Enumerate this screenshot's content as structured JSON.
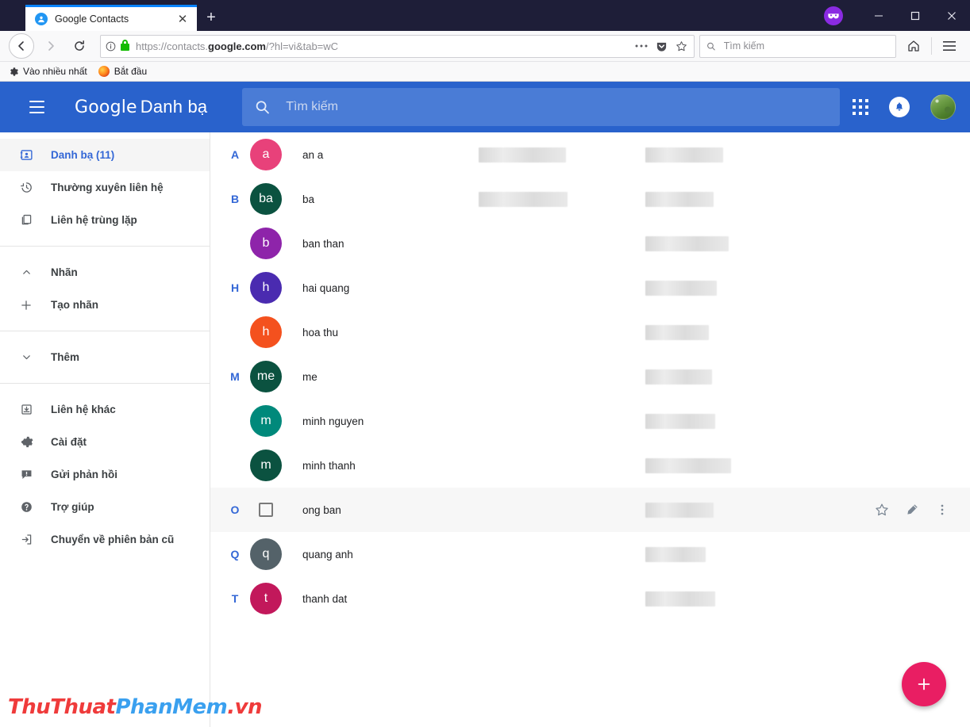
{
  "browser": {
    "tab": {
      "title": "Google Contacts",
      "favicon": "contact-favicon",
      "close_label": "✕"
    },
    "newtab_label": "+",
    "window_controls": {
      "minimize": "–",
      "maximize": "□",
      "close": "✕",
      "extension": "mask-icon"
    },
    "nav": {
      "back": "←",
      "forward": "→",
      "reload": "⟳",
      "home": "⌂",
      "menu": "≡"
    },
    "url": {
      "scheme": "https://contacts.",
      "domain": "google.com",
      "path": "/?hl=vi&tab=wC",
      "full": "https://contacts.google.com/?hl=vi&tab=wC"
    },
    "url_icons": [
      "more-dots-icon",
      "pocket-icon",
      "bookmark-star-icon"
    ],
    "search": {
      "placeholder": "Tìm kiếm",
      "value": ""
    },
    "bookmarks": [
      {
        "label": "Vào nhiều nhất",
        "icon": "gear-icon"
      },
      {
        "label": "Bắt đầu",
        "icon": "firefox-icon"
      }
    ]
  },
  "app": {
    "brand_google": "Google",
    "brand_product": "Danh bạ",
    "search": {
      "placeholder": "Tìm kiếm",
      "value": ""
    },
    "header_icons": [
      "apps-grid-icon",
      "notification-bell-icon",
      "user-avatar"
    ],
    "sidebar": {
      "group1": [
        {
          "label": "Danh bạ (11)",
          "icon": "contact-card-icon",
          "active": true
        },
        {
          "label": "Thường xuyên liên hệ",
          "icon": "history-clock-icon",
          "active": false
        },
        {
          "label": "Liên hệ trùng lặp",
          "icon": "duplicate-copy-icon",
          "active": false
        }
      ],
      "group2": [
        {
          "label": "Nhãn",
          "icon": "chevron-up-icon",
          "active": false
        },
        {
          "label": "Tạo nhãn",
          "icon": "plus-icon",
          "active": false
        }
      ],
      "group3": [
        {
          "label": "Thêm",
          "icon": "chevron-down-icon",
          "active": false
        }
      ],
      "group4": [
        {
          "label": "Liên hệ khác",
          "icon": "inbox-arrow-icon",
          "active": false
        },
        {
          "label": "Cài đặt",
          "icon": "gear-icon",
          "active": false
        },
        {
          "label": "Gửi phản hồi",
          "icon": "feedback-icon",
          "active": false
        },
        {
          "label": "Trợ giúp",
          "icon": "help-circle-icon",
          "active": false
        },
        {
          "label": "Chuyển về phiên bản cũ",
          "icon": "exit-arrow-icon",
          "active": false
        }
      ]
    },
    "contacts": [
      {
        "letter": "A",
        "initials": "a",
        "name": "an a",
        "color": "#e8417a",
        "hovered": false,
        "email_redacted": true,
        "phone_redacted": true,
        "email_w": 110,
        "phone_w": 98
      },
      {
        "letter": "B",
        "initials": "ba",
        "name": "ba",
        "color": "#0b5240",
        "hovered": false,
        "email_redacted": true,
        "phone_redacted": true,
        "email_w": 112,
        "phone_w": 86
      },
      {
        "letter": "",
        "initials": "b",
        "name": "ban than",
        "color": "#8e24aa",
        "hovered": false,
        "email_redacted": false,
        "phone_redacted": true,
        "email_w": 0,
        "phone_w": 105
      },
      {
        "letter": "H",
        "initials": "h",
        "name": "hai quang",
        "color": "#4a2bb0",
        "hovered": false,
        "email_redacted": false,
        "phone_redacted": true,
        "email_w": 0,
        "phone_w": 90
      },
      {
        "letter": "",
        "initials": "h",
        "name": "hoa thu",
        "color": "#f4511e",
        "hovered": false,
        "email_redacted": false,
        "phone_redacted": true,
        "email_w": 0,
        "phone_w": 80
      },
      {
        "letter": "M",
        "initials": "me",
        "name": "me",
        "color": "#0b5240",
        "hovered": false,
        "email_redacted": false,
        "phone_redacted": true,
        "email_w": 0,
        "phone_w": 84
      },
      {
        "letter": "",
        "initials": "m",
        "name": "minh nguyen",
        "color": "#00897b",
        "hovered": false,
        "email_redacted": false,
        "phone_redacted": true,
        "email_w": 0,
        "phone_w": 88
      },
      {
        "letter": "",
        "initials": "m",
        "name": "minh thanh",
        "color": "#0b5240",
        "hovered": false,
        "email_redacted": false,
        "phone_redacted": true,
        "email_w": 0,
        "phone_w": 108
      },
      {
        "letter": "O",
        "initials": "",
        "name": "ong ban",
        "color": "",
        "hovered": true,
        "email_redacted": false,
        "phone_redacted": true,
        "email_w": 0,
        "phone_w": 86
      },
      {
        "letter": "Q",
        "initials": "q",
        "name": "quang anh",
        "color": "#546269",
        "hovered": false,
        "email_redacted": false,
        "phone_redacted": true,
        "email_w": 0,
        "phone_w": 76
      },
      {
        "letter": "T",
        "initials": "t",
        "name": "thanh dat",
        "color": "#c2185b",
        "hovered": false,
        "email_redacted": false,
        "phone_redacted": true,
        "email_w": 0,
        "phone_w": 88
      }
    ],
    "row_actions": [
      "star-icon",
      "pencil-edit-icon",
      "more-vertical-icon"
    ],
    "fab": {
      "label": "+",
      "icon": "plus-icon",
      "color": "#e91e63"
    },
    "colors": {
      "header_blue": "#2962cc",
      "accent_blue": "#3367d6",
      "fab_pink": "#e91e63"
    }
  },
  "watermark": {
    "part1": "ThuThuat",
    "part2": "PhanMem",
    "part3": ".vn"
  }
}
